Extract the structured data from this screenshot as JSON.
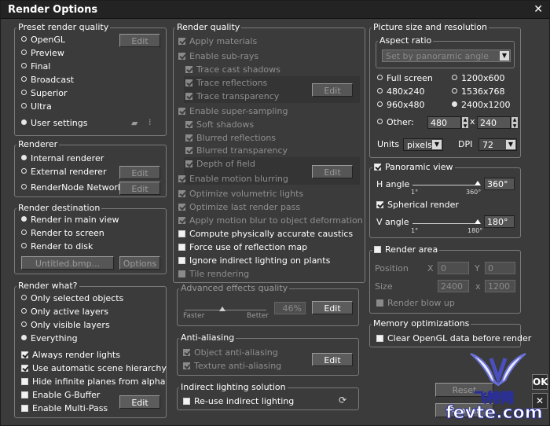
{
  "window": {
    "title": "Render Options",
    "close_glyph": "✕"
  },
  "preset": {
    "title": "Preset render quality",
    "items": [
      "OpenGL",
      "Preview",
      "Final",
      "Broadcast",
      "Superior",
      "Ultra",
      "User settings"
    ],
    "edit": "Edit"
  },
  "renderer": {
    "title": "Renderer",
    "items": [
      "Internal renderer",
      "External renderer",
      "RenderNode Network"
    ],
    "edit": "Edit"
  },
  "destination": {
    "title": "Render destination",
    "items": [
      "Render in main view",
      "Render to screen",
      "Render to disk"
    ],
    "file": "Untitled.bmp...",
    "options": "Options"
  },
  "what": {
    "title": "Render what?",
    "radios": [
      "Only selected objects",
      "Only active layers",
      "Only visible layers",
      "Everything"
    ],
    "checks": [
      "Always render lights",
      "Use automatic scene hierarchy",
      "Hide infinite planes from alpha",
      "Enable G-Buffer",
      "Enable Multi-Pass"
    ],
    "edit": "Edit"
  },
  "quality": {
    "title": "Render quality",
    "items": [
      "Apply materials",
      "Enable sub-rays",
      "Trace cast shadows",
      "Trace reflections",
      "Trace transparency",
      "Enable super-sampling",
      "Soft shadows",
      "Blurred reflections",
      "Blurred transparency",
      "Depth of field",
      "Enable motion blurring",
      "Optimize volumetric lights",
      "Optimize last render pass",
      "Apply motion blur to object deformation",
      "Compute physically accurate caustics",
      "Force use of reflection map",
      "Ignore indirect lighting on plants",
      "Tile rendering"
    ],
    "edit": "Edit"
  },
  "advanced": {
    "title": "Advanced effects quality",
    "faster": "Faster",
    "better": "Better",
    "value": "46%",
    "level": 0.46,
    "edit": "Edit"
  },
  "antialias": {
    "title": "Anti-aliasing",
    "items": [
      "Object anti-aliasing",
      "Texture anti-aliasing"
    ],
    "edit": "Edit"
  },
  "indirect": {
    "title": "Indirect lighting solution",
    "item": "Re-use indirect lighting",
    "refresh_icon": "refresh-icon"
  },
  "picture": {
    "title": "Picture size and resolution",
    "aspect_title": "Aspect ratio",
    "aspect_value": "Set by panoramic angle",
    "sizes": [
      "Full screen",
      "1200x600",
      "480x240",
      "1536x768",
      "960x480",
      "2400x1200"
    ],
    "other": "Other:",
    "width": "480",
    "height": "240",
    "x_sep": "x",
    "units_label": "Units",
    "units_value": "pixels",
    "dpi_label": "DPI",
    "dpi_value": "72"
  },
  "panoramic": {
    "title": "Panoramic view",
    "h_label": "H angle",
    "h_min": "1°",
    "h_max": "360°",
    "h_value": "360°",
    "spherical": "Spherical render",
    "v_label": "V angle",
    "v_min": "1°",
    "v_max": "180°",
    "v_value": "180°"
  },
  "area": {
    "title": "Render area",
    "position": "Position",
    "x_label": "X",
    "x_value": "0",
    "y_label": "Y",
    "y_value": "0",
    "size": "Size",
    "w_value": "2400",
    "x_sep": "x",
    "h_value": "1200",
    "blow": "Render blow up"
  },
  "memory": {
    "title": "Memory optimizations",
    "item": "Clear OpenGL data before render"
  },
  "actions": {
    "reset": "Reset",
    "render": "Render",
    "ok": "OK",
    "cancel": "✕"
  },
  "watermark": {
    "brand": "飞特网",
    "site": "fevte.com"
  }
}
